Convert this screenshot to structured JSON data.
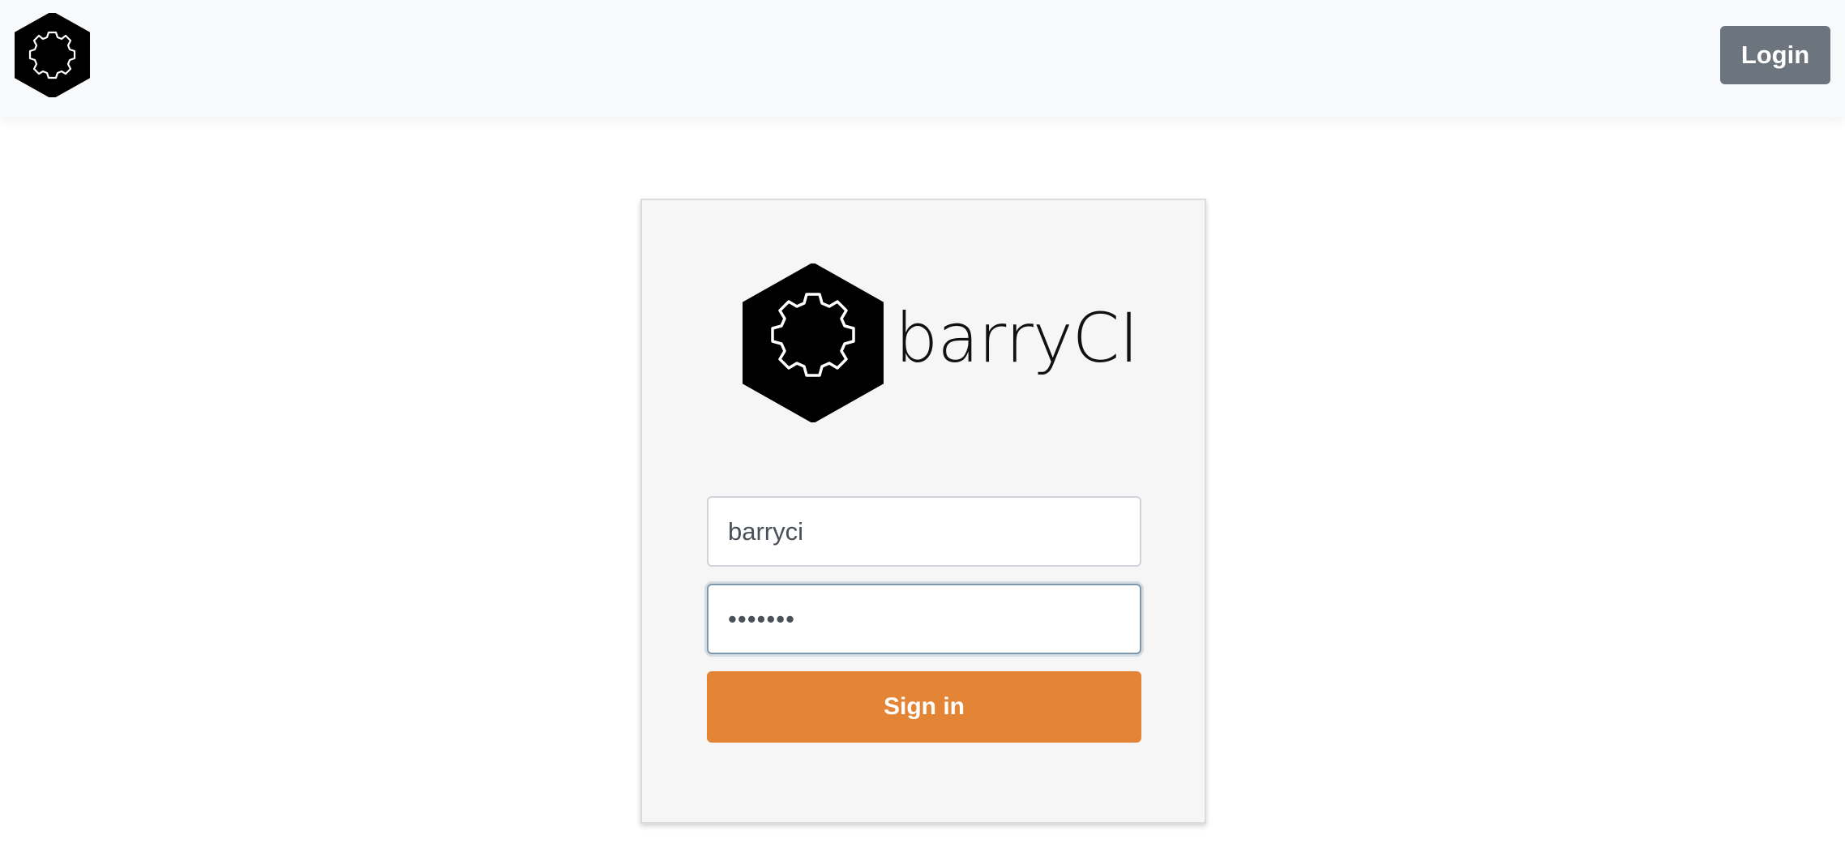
{
  "navbar": {
    "logo_icon": "barryci-gear-hexagon-icon",
    "login_label": "Login"
  },
  "card": {
    "brand_icon": "barryci-gear-hexagon-icon",
    "brand_name": "barryCI",
    "username": {
      "value": "barryci"
    },
    "password": {
      "value": "•••••••"
    },
    "signin_label": "Sign in"
  },
  "colors": {
    "navbar_bg": "#f8f9fa",
    "login_button": "#6c757d",
    "signin_button": "#e38535",
    "card_bg": "#f6f6f6"
  }
}
